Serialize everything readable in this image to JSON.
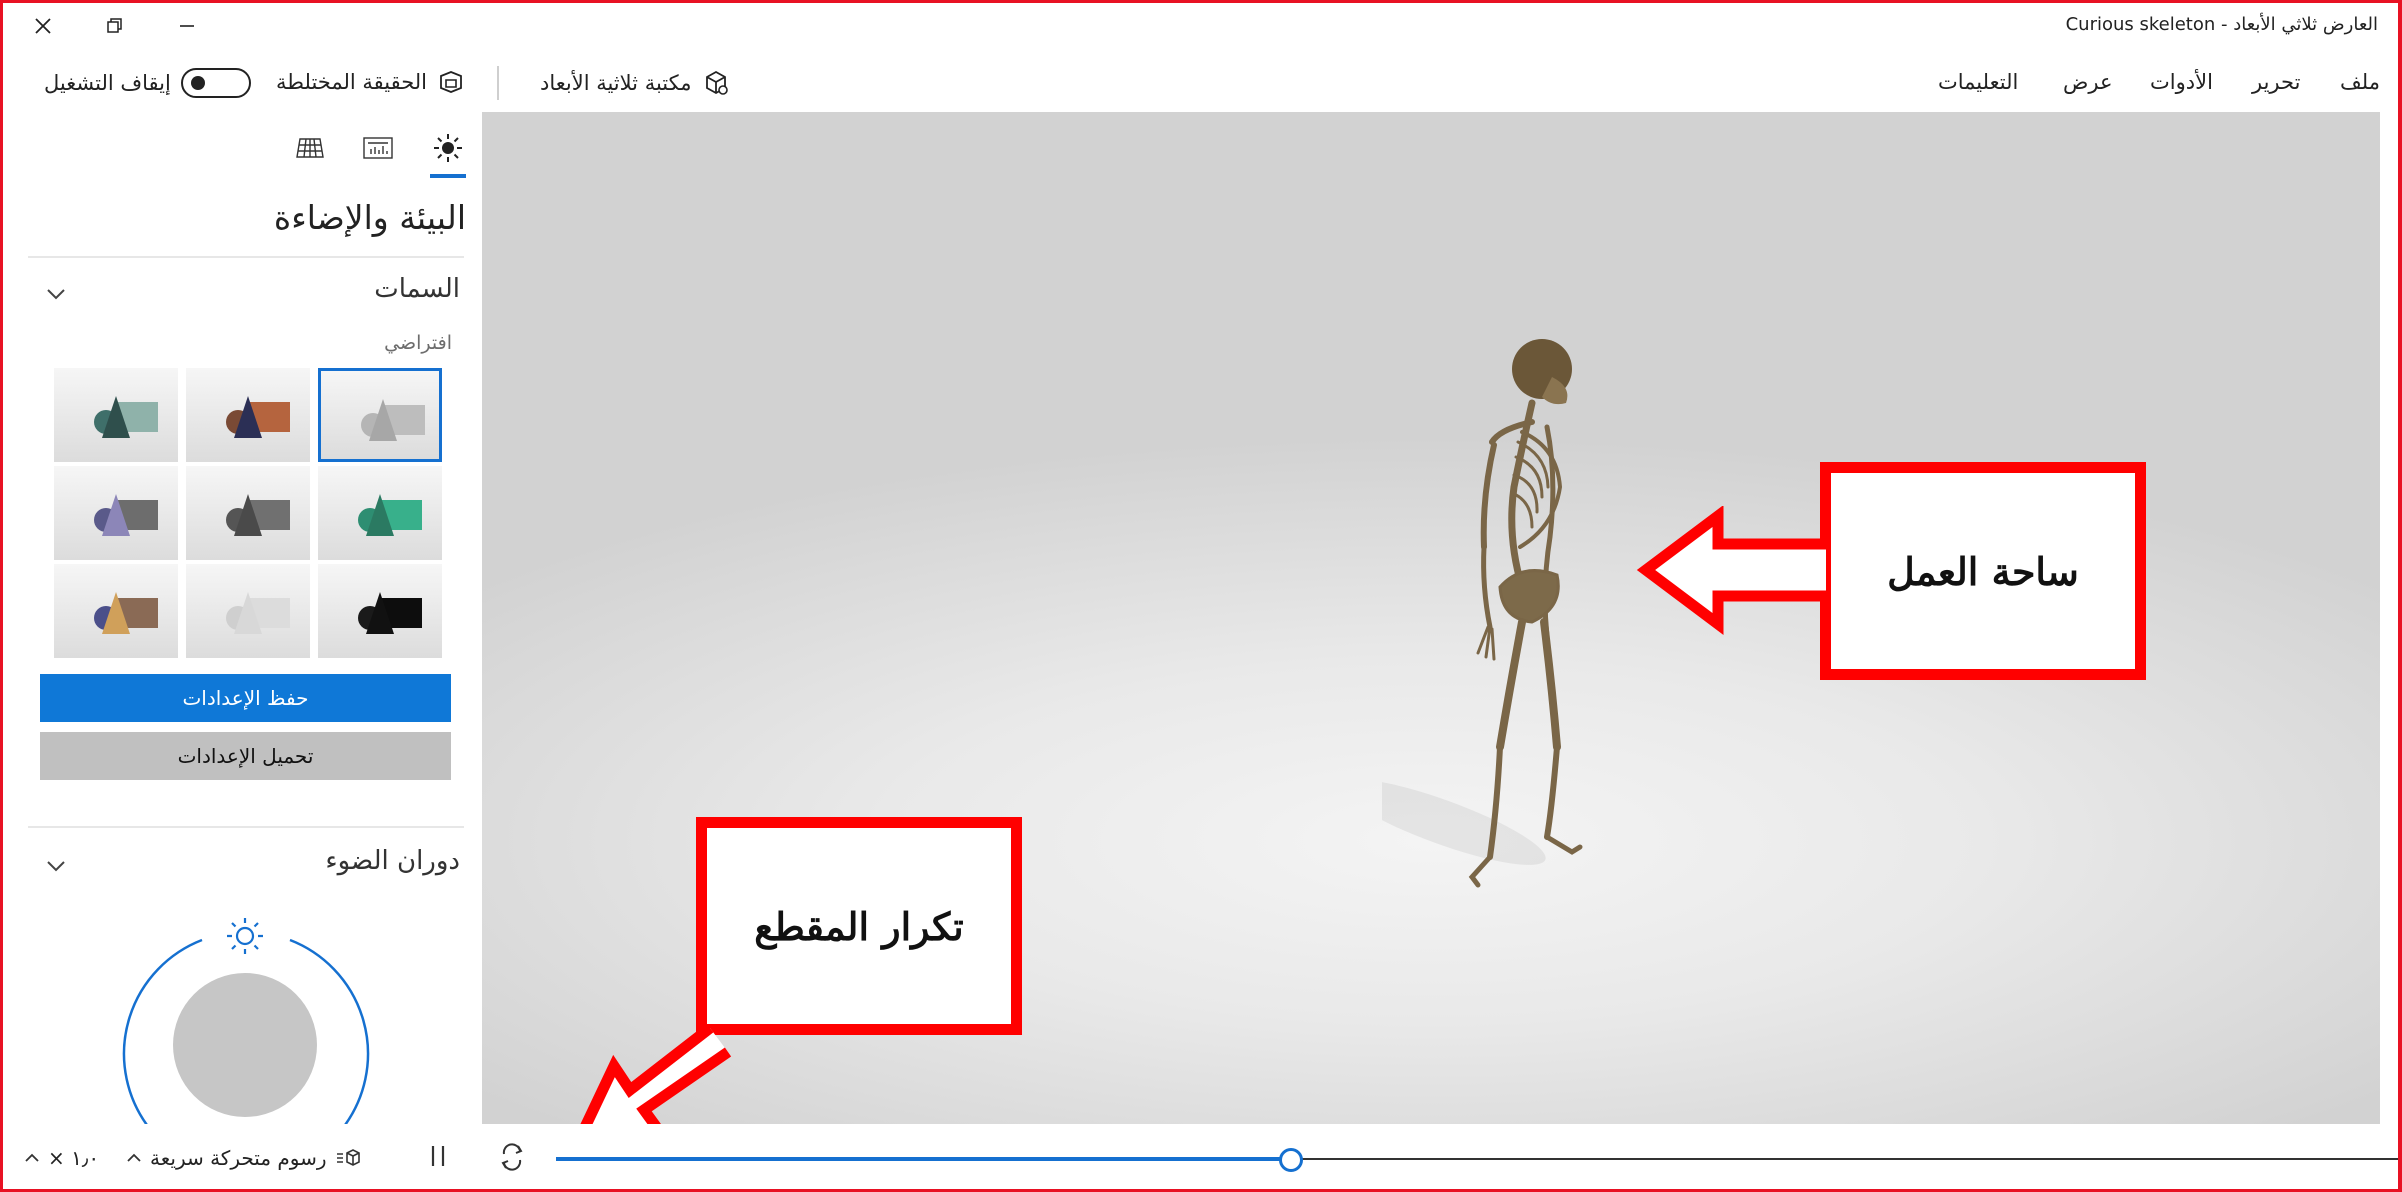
{
  "window": {
    "title": "Curious skeleton - العارض ثلاثي الأبعاد"
  },
  "commandbar": {
    "stop_label": "إيقاف التشغيل",
    "mixed_reality_label": "الحقيقة المختلطة",
    "library_label": "مكتبة ثلاثية الأبعاد",
    "menus": [
      "ملف",
      "تحرير",
      "الأدوات",
      "عرض",
      "التعليمات"
    ]
  },
  "panel": {
    "title": "البيئة والإضاءة",
    "themes_title": "السمات",
    "default_label": "افتراضي",
    "save_label": "حفظ الإعدادات",
    "load_label": "تحميل الإعدادات",
    "light_rotation_title": "دوران الضوء",
    "tab_icons": [
      "grid-icon",
      "stats-icon",
      "sun-icon"
    ],
    "themes": [
      {
        "sphere": "#b5b5b5",
        "cone": "#a7a7a7",
        "box": "#bdbdbd",
        "selected": true
      },
      {
        "sphere": "#7a4a35",
        "cone": "#2b2f55",
        "box": "#b5643e",
        "selected": false
      },
      {
        "sphere": "#3f6f6a",
        "cone": "#2f4f4c",
        "box": "#8fb2aa",
        "selected": false
      },
      {
        "sphere": "#2e8e72",
        "cone": "#2b7a62",
        "box": "#38b08b",
        "selected": false
      },
      {
        "sphere": "#555555",
        "cone": "#4a4a4a",
        "box": "#707070",
        "selected": false
      },
      {
        "sphere": "#5a5a8a",
        "cone": "#8c86b8",
        "box": "#6d6d6d",
        "selected": false
      },
      {
        "sphere": "#1a1a1a",
        "cone": "#111111",
        "box": "#0d0d0d",
        "selected": false
      },
      {
        "sphere": "#cfcfcf",
        "cone": "#d8d8d8",
        "box": "#dcdcdc",
        "selected": false
      },
      {
        "sphere": "#4b4f8a",
        "cone": "#d0a05a",
        "box": "#8a6a55",
        "selected": false
      }
    ]
  },
  "annotations": {
    "workspace_label": "ساحة العمل",
    "repeat_label": "تكرار المقطع"
  },
  "playback": {
    "animation_label": "رسوم متحركة سريعة",
    "speed_label": "× ١٫٠",
    "progress": 0.5
  },
  "colors": {
    "accent": "#1570d0",
    "annotation": "#ff0000"
  }
}
